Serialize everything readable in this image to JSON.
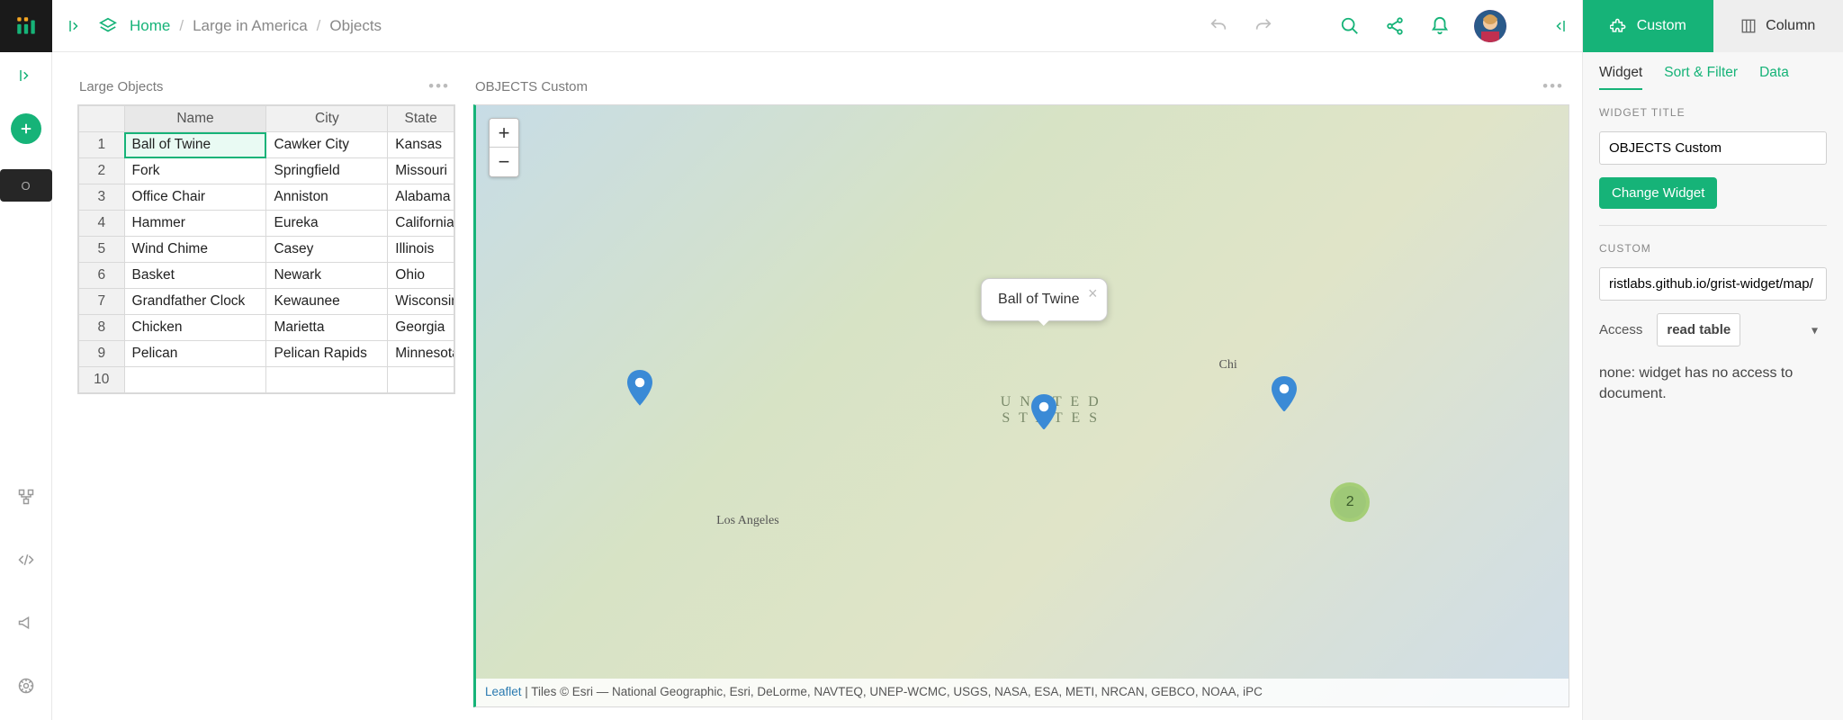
{
  "breadcrumb": {
    "home": "Home",
    "doc": "Large in America",
    "page": "Objects"
  },
  "leftbar": {
    "page_initial": "O"
  },
  "table_panel": {
    "title": "Large Objects",
    "columns": [
      "Name",
      "City",
      "State"
    ],
    "rows": [
      {
        "n": "1",
        "name": "Ball of Twine",
        "city": "Cawker City",
        "state": "Kansas",
        "selected": true
      },
      {
        "n": "2",
        "name": "Fork",
        "city": "Springfield",
        "state": "Missouri"
      },
      {
        "n": "3",
        "name": "Office Chair",
        "city": "Anniston",
        "state": "Alabama"
      },
      {
        "n": "4",
        "name": "Hammer",
        "city": "Eureka",
        "state": "California"
      },
      {
        "n": "5",
        "name": "Wind Chime",
        "city": "Casey",
        "state": "Illinois"
      },
      {
        "n": "6",
        "name": "Basket",
        "city": "Newark",
        "state": "Ohio"
      },
      {
        "n": "7",
        "name": "Grandfather Clock",
        "city": "Kewaunee",
        "state": "Wisconsin"
      },
      {
        "n": "8",
        "name": "Chicken",
        "city": "Marietta",
        "state": "Georgia"
      },
      {
        "n": "9",
        "name": "Pelican",
        "city": "Pelican Rapids",
        "state": "Minnesota"
      },
      {
        "n": "10",
        "name": "",
        "city": "",
        "state": ""
      }
    ]
  },
  "map_panel": {
    "title": "OBJECTS Custom",
    "popup": "Ball of Twine",
    "cluster_count": "2",
    "zoom_in": "+",
    "zoom_out": "−",
    "labels": {
      "united_states": "UNITED\nSTATES",
      "la": "Los Angeles",
      "chi": "Chi"
    },
    "attribution_link": "Leaflet",
    "attribution_text": " | Tiles © Esri — National Geographic, Esri, DeLorme, NAVTEQ, UNEP-WCMC, USGS, NASA, ESA, METI, NRCAN, GEBCO, NOAA, iPC"
  },
  "rightbar": {
    "tab_custom": "Custom",
    "tab_column": "Column",
    "subtabs": {
      "widget": "Widget",
      "sort": "Sort & Filter",
      "data": "Data"
    },
    "widget_title_label": "WIDGET TITLE",
    "widget_title_value": "OBJECTS Custom",
    "change_widget": "Change Widget",
    "custom_label": "CUSTOM",
    "url_value": "ristlabs.github.io/grist-widget/map/",
    "access_label": "Access",
    "access_value": "read table",
    "help_text": "none: widget has no access to document."
  }
}
